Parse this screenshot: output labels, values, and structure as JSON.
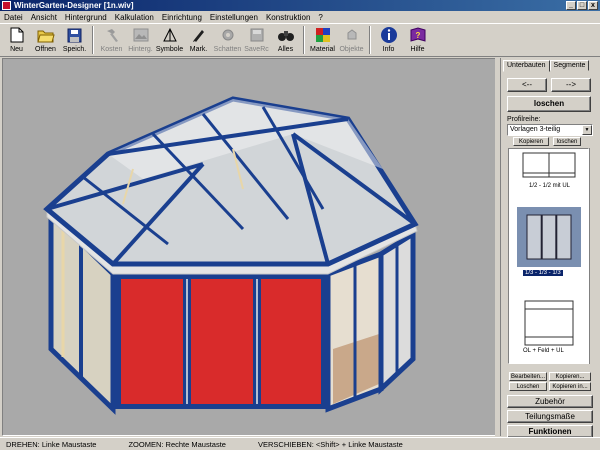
{
  "window": {
    "title": "WinterGarten-Designer   [1n.wiv]",
    "minimize": "_",
    "maximize": "□",
    "close": "x"
  },
  "menu": [
    "Datei",
    "Ansicht",
    "Hintergrund",
    "Kalkulation",
    "Einrichtung",
    "Einstellungen",
    "Konstruktion",
    "?"
  ],
  "toolbar": [
    {
      "label": "Neu",
      "icon": "new-file-icon",
      "enabled": true
    },
    {
      "label": "Offnen",
      "icon": "open-folder-icon",
      "enabled": true
    },
    {
      "label": "Speich.",
      "icon": "save-disk-icon",
      "enabled": true
    },
    {
      "label": "Kosten",
      "icon": "hammer-icon",
      "enabled": false
    },
    {
      "label": "Hinterg.",
      "icon": "background-icon",
      "enabled": false
    },
    {
      "label": "Symbole",
      "icon": "symbols-icon",
      "enabled": true
    },
    {
      "label": "Mark.",
      "icon": "marker-icon",
      "enabled": true
    },
    {
      "label": "Schatten",
      "icon": "shadow-gear-icon",
      "enabled": false
    },
    {
      "label": "SaveRc",
      "icon": "save-render-icon",
      "enabled": false
    },
    {
      "label": "Alles",
      "icon": "binoculars-icon",
      "enabled": true
    },
    {
      "label": "Material",
      "icon": "material-icon",
      "enabled": true
    },
    {
      "label": "Objekte",
      "icon": "objects-icon",
      "enabled": false
    },
    {
      "label": "Info",
      "icon": "info-icon",
      "enabled": true
    },
    {
      "label": "Hilfe",
      "icon": "help-book-icon",
      "enabled": true
    }
  ],
  "panel": {
    "tabs": [
      "Unterbauten",
      "Segmente"
    ],
    "active_tab": "Unterbauten",
    "prev": "<--",
    "next": "-->",
    "delete_label": "loschen",
    "profile_label": "Profilreihe:",
    "profile_value": "Vorlagen 3-teilig",
    "copy_label": "Kopieren",
    "delete_small": "loschen",
    "presets": [
      {
        "label": "1/2 - 1/2 mit UL",
        "selected": false
      },
      {
        "label": "1/3 - 1/3 - 1/3",
        "selected": true
      },
      {
        "label": "OL + Feld + UL",
        "selected": false
      }
    ],
    "edit_label": "Bearbeiten...",
    "copy_dots_label": "Kopieren...",
    "delete_dots_label": "Loschen",
    "copy_in_label": "Kopieren in...",
    "accessories": "Zubehör",
    "division": "Teilungsmaße",
    "functions": "Funktionen"
  },
  "status": {
    "rotate": "DREHEN: Linke Maustaste",
    "zoom": "ZOOMEN: Rechte Maustaste",
    "move": "VERSCHIEBEN: <Shift> + Linke Maustaste"
  },
  "colors": {
    "frame_blue": "#1a3f8f",
    "panel_red": "#d92b2b",
    "background_gray": "#a9a9a9",
    "wood": "#e8d6a8",
    "selection": "#0a246a"
  }
}
